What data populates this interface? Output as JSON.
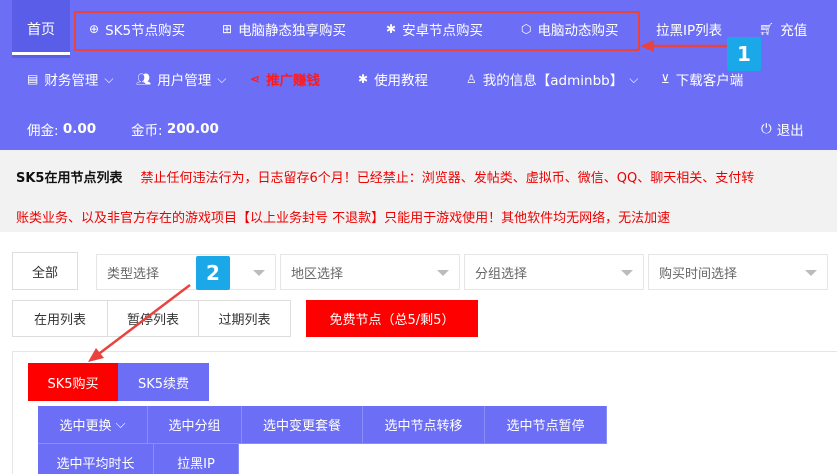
{
  "nav": {
    "home": "首页",
    "sk5_buy": "SK5节点购买",
    "pc_static": "电脑静态独享购买",
    "android_buy": "安卓节点购买",
    "pc_dynamic": "电脑动态购买",
    "blacklist": "拉黑IP列表",
    "recharge": "充值",
    "finance": "财务管理",
    "users": "用户管理",
    "promote": "推广赚钱",
    "tutorial": "使用教程",
    "my_info": "我的信息【adminbb】",
    "download": "下载客户端"
  },
  "account": {
    "commission_label": "佣金:",
    "commission_value": "0.00",
    "coins_label": "金币:",
    "coins_value": "200.00",
    "logout": "退出"
  },
  "notice": {
    "title": "SK5在用节点列表",
    "line1": "禁止任何违法行为，日志留存6个月！已经禁止：浏览器、发帖类、虚拟币、微信、QQ、聊天相关、支付转",
    "line2": "账类业务、以及非官方存在的游戏项目【以上业务封号 不退款】只能用于游戏使用！其他软件均无网络，无法加速"
  },
  "filters": {
    "all": "全部",
    "type": "类型选择",
    "region": "地区选择",
    "group": "分组选择",
    "time": "购买时间选择"
  },
  "tabs": {
    "in_use": "在用列表",
    "paused": "暂停列表",
    "expired": "过期列表",
    "free": "免费节点（总5/剩5）"
  },
  "buttons": {
    "sk5_buy": "SK5购买",
    "sk5_renew": "SK5续费"
  },
  "actions": {
    "replace": "选中更换",
    "group": "选中分组",
    "change_plan": "选中变更套餐",
    "transfer": "选中节点转移",
    "pause": "选中节点暂停",
    "average": "选中平均时长",
    "block_ip": "拉黑IP"
  },
  "annotations": {
    "badge1": "1",
    "badge2": "2"
  },
  "colors": {
    "primary": "#6c6ff6",
    "danger": "#ff0000",
    "badge": "#1aa8e8",
    "highlight": "#e8433f"
  }
}
